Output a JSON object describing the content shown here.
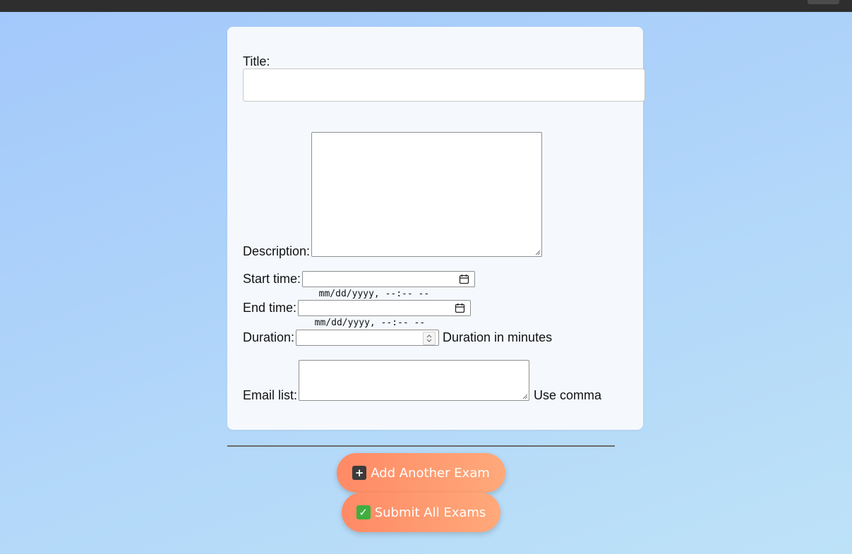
{
  "form": {
    "title_label": "Title:",
    "title_value": "",
    "description_label": "Description:",
    "description_value": "",
    "start_label": "Start time:",
    "start_placeholder": "mm/dd/yyyy, --:-- --",
    "end_label": "End time:",
    "end_placeholder": "mm/dd/yyyy, --:-- --",
    "duration_label": "Duration:",
    "duration_value": "",
    "duration_hint": "Duration in minutes",
    "email_label": "Email list:",
    "email_value": "",
    "email_hint": "Use comma"
  },
  "actions": {
    "add_icon": "plus-icon",
    "add_label": "Add Another Exam",
    "submit_icon": "check-icon",
    "submit_label": "Submit All Exams"
  },
  "colors": {
    "background": "#a3c8fb",
    "card": "#f5f9fe",
    "button_gradient_start": "#ff8a65",
    "button_gradient_end": "#ffa97a"
  }
}
